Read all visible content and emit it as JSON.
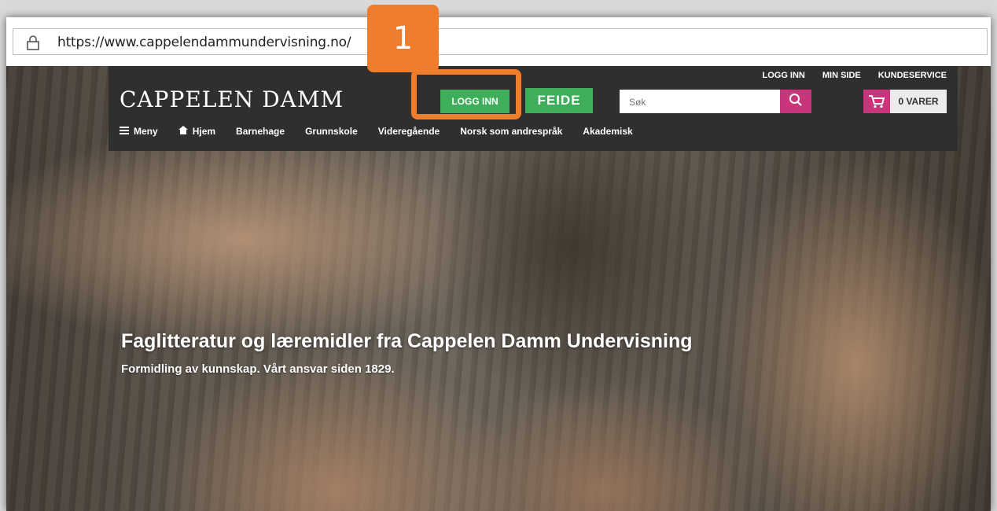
{
  "browser": {
    "url": "https://www.cappelendammundervisning.no/"
  },
  "site": {
    "toplinks": [
      "LOGG INN",
      "MIN SIDE",
      "KUNDESERVICE"
    ],
    "logo": "CAPPELEN DAMM",
    "login_button": "LOGG INN",
    "feide_button": "FEIDE",
    "search_placeholder": "Søk",
    "cart_label": "0 VARER",
    "nav": [
      {
        "label": "Meny",
        "icon": "menu-icon"
      },
      {
        "label": "Hjem",
        "icon": "home-icon"
      },
      {
        "label": "Barnehage"
      },
      {
        "label": "Grunnskole"
      },
      {
        "label": "Videregående"
      },
      {
        "label": "Norsk som andrespråk"
      },
      {
        "label": "Akademisk"
      }
    ]
  },
  "hero": {
    "title": "Faglitteratur og læremidler fra Cappelen Damm Undervisning",
    "subtitle": "Formidling av kunnskap. Vårt ansvar siden 1829."
  },
  "annotation": {
    "badge": "1",
    "color": "#ef7d2c"
  },
  "colors": {
    "login_green": "#3fae5b",
    "accent_pink": "#c8357a",
    "header_dark": "#2f2f2f"
  }
}
